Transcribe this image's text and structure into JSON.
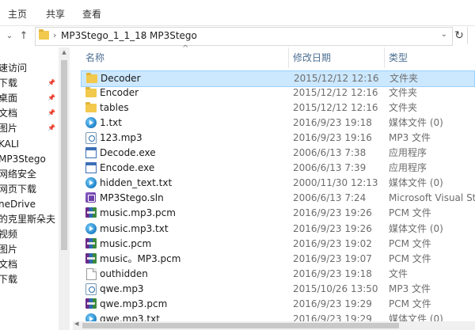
{
  "ribbon": {
    "tabs": [
      "主页",
      "共享",
      "查看"
    ]
  },
  "address": {
    "crumbs": [
      "MP3Stego_1_1_18",
      "MP3Stego"
    ]
  },
  "sidebar": {
    "items": [
      {
        "label": "速访问",
        "pinned": false
      },
      {
        "label": "下载",
        "pinned": true
      },
      {
        "label": "桌面",
        "pinned": true
      },
      {
        "label": "文档",
        "pinned": true
      },
      {
        "label": "图片",
        "pinned": true
      },
      {
        "label": "KALI",
        "pinned": false
      },
      {
        "label": "MP3Stego",
        "pinned": false
      },
      {
        "label": "网络安全",
        "pinned": false
      },
      {
        "label": "网页下载",
        "pinned": false
      },
      {
        "label": "neDrive",
        "pinned": false
      },
      {
        "label": "的克里斯朵夫",
        "pinned": false
      },
      {
        "label": "视频",
        "pinned": false
      },
      {
        "label": "图片",
        "pinned": false
      },
      {
        "label": "文档",
        "pinned": false
      },
      {
        "label": "下载",
        "pinned": false
      }
    ]
  },
  "columns": {
    "name": "名称",
    "date": "修改日期",
    "type": "类型"
  },
  "files": [
    {
      "name": "Decoder",
      "date": "2015/12/12 12:16",
      "type": "文件夹",
      "icon": "folder-icon",
      "selected": true
    },
    {
      "name": "Encoder",
      "date": "2015/12/12 12:16",
      "type": "文件夹",
      "icon": "folder-icon"
    },
    {
      "name": "tables",
      "date": "2015/12/12 12:16",
      "type": "文件夹",
      "icon": "folder-icon"
    },
    {
      "name": "1.txt",
      "date": "2016/9/23 19:18",
      "type": "媒体文件 (0)",
      "icon": "media-file-icon"
    },
    {
      "name": "123.mp3",
      "date": "2016/9/23 19:16",
      "type": "MP3 文件",
      "icon": "mp3-file-icon"
    },
    {
      "name": "Decode.exe",
      "date": "2006/6/13 7:38",
      "type": "应用程序",
      "icon": "exe-icon"
    },
    {
      "name": "Encode.exe",
      "date": "2006/6/13 7:39",
      "type": "应用程序",
      "icon": "exe-icon"
    },
    {
      "name": "hidden_text.txt",
      "date": "2000/11/30 12:13",
      "type": "媒体文件 (0)",
      "icon": "media-file-icon"
    },
    {
      "name": "MP3Stego.sln",
      "date": "2006/6/13 7:24",
      "type": "Microsoft Visual St...",
      "icon": "visual-studio-solution-icon"
    },
    {
      "name": "music.mp3.pcm",
      "date": "2016/9/23 19:26",
      "type": "PCM 文件",
      "icon": "pcm-file-icon"
    },
    {
      "name": "music.mp3.txt",
      "date": "2016/9/23 19:26",
      "type": "媒体文件 (0)",
      "icon": "media-file-icon"
    },
    {
      "name": "music.pcm",
      "date": "2016/9/23 19:02",
      "type": "PCM 文件",
      "icon": "pcm-file-icon"
    },
    {
      "name": "music。MP3.pcm",
      "date": "2016/9/23 19:07",
      "type": "PCM 文件",
      "icon": "pcm-file-icon"
    },
    {
      "name": "outhidden",
      "date": "2016/9/23 19:18",
      "type": "文件",
      "icon": "blank-file-icon"
    },
    {
      "name": "qwe.mp3",
      "date": "2015/10/26 13:50",
      "type": "MP3 文件",
      "icon": "mp3-file-icon"
    },
    {
      "name": "qwe.mp3.pcm",
      "date": "2016/9/23 19:29",
      "type": "PCM 文件",
      "icon": "pcm-file-icon"
    },
    {
      "name": "qwe.mp3.txt",
      "date": "2016/9/23 19:29",
      "type": "媒体文件 (0)",
      "icon": "media-file-icon"
    }
  ],
  "colors": {
    "selection": "#cce8ff",
    "selection_border": "#99d1ff",
    "header_text": "#4d6f92"
  }
}
